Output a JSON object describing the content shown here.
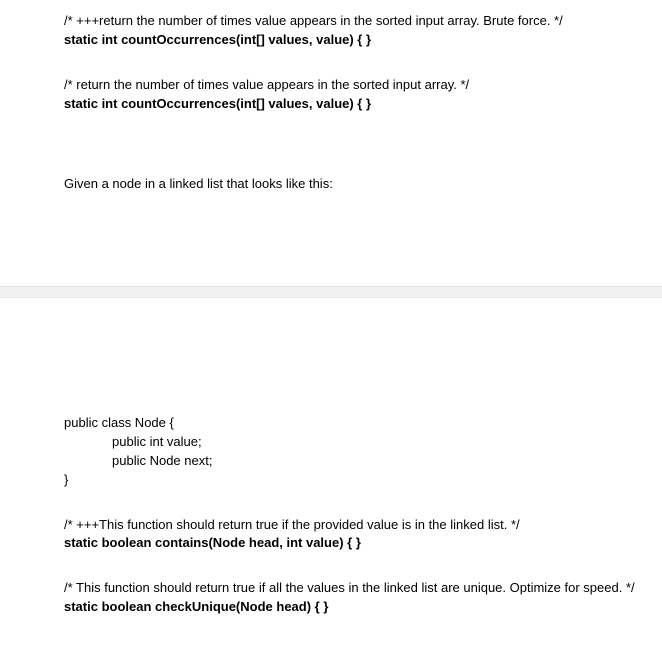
{
  "section1": {
    "block1": {
      "comment": "/* +++return the number of times value appears in the sorted input array.  Brute force. */",
      "signature": "static int countOccurrences(int[] values, value) { }"
    },
    "block2": {
      "comment": "/*  return the number of times value appears in the sorted input array.  */",
      "signature": "static int countOccurrences(int[] values, value) { }"
    },
    "prose": "Given a node in a linked list that looks like this:"
  },
  "section2": {
    "class": {
      "line1": "public class Node {",
      "line2": "public int value;",
      "line3": "public Node next;",
      "line4": "}"
    },
    "block1": {
      "comment": "/* +++This function should return true if the provided value is in the linked list. */",
      "signature": "static boolean contains(Node head, int value) { }"
    },
    "block2": {
      "comment": "/* This function should return true if all the values in the linked list are unique. Optimize for speed. */",
      "signature": "static boolean checkUnique(Node head) { }"
    }
  }
}
